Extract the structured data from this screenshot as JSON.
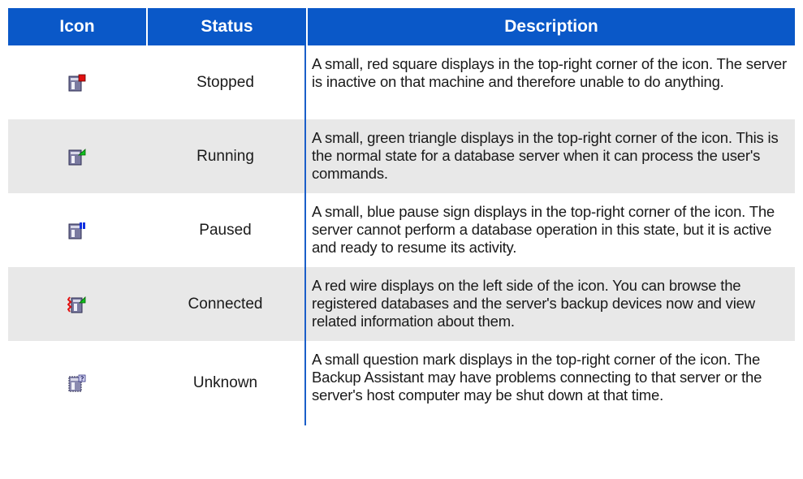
{
  "headers": {
    "icon": "Icon",
    "status": "Status",
    "description": "Description"
  },
  "rows": [
    {
      "icon": "server-stopped-icon",
      "status": "Stopped",
      "description": "A small, red square displays in the top-right corner of the icon. The server is inactive on that machine and therefore unable to do anything."
    },
    {
      "icon": "server-running-icon",
      "status": "Running",
      "description": "A small, green triangle displays in the top-right corner of the icon. This is the normal state for a database server when it can process the user's commands."
    },
    {
      "icon": "server-paused-icon",
      "status": "Paused",
      "description": "A small, blue pause sign displays in the top-right corner of the icon. The server cannot perform a database operation in this state, but it is active and ready to resume its activity."
    },
    {
      "icon": "server-connected-icon",
      "status": "Connected",
      "description": "A red wire displays on the left side of the icon. You can browse the registered databases and the server's backup devices now and view related information about them."
    },
    {
      "icon": "server-unknown-icon",
      "status": "Unknown",
      "description": "A small question mark displays in the top-right corner of the icon. The Backup Assistant may have problems connecting to that server or the server's host computer may be shut down at that time."
    }
  ],
  "colors": {
    "header_background": "#0a58c8",
    "row_shading": "#e8e8e8",
    "column_divider": "#1b5fc9"
  }
}
